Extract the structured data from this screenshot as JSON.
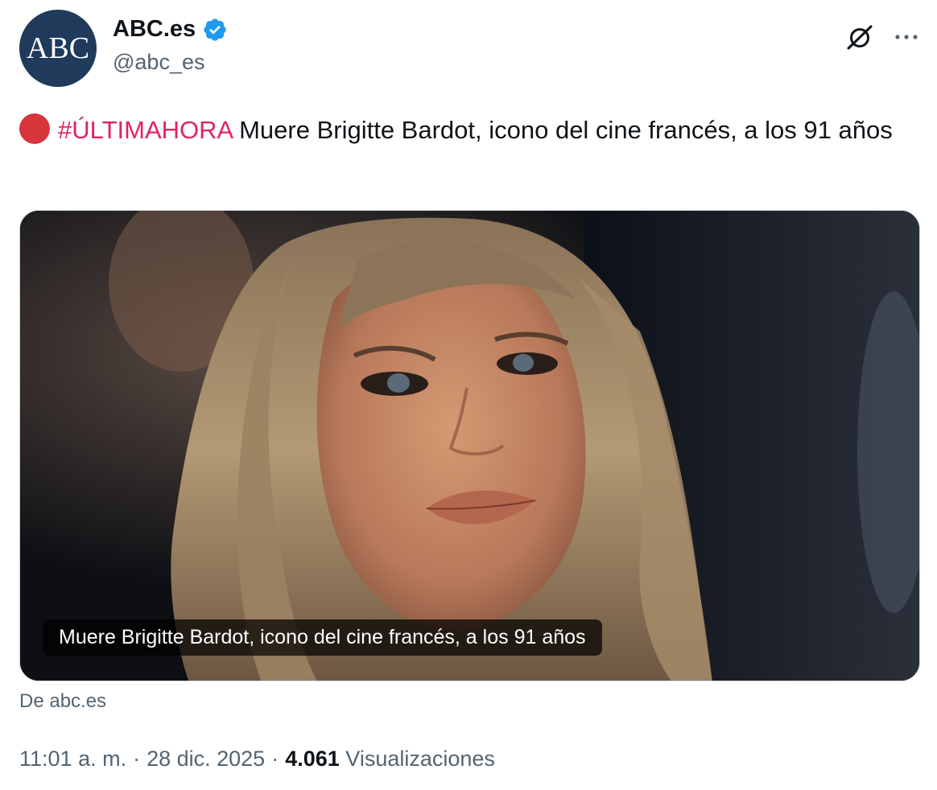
{
  "account": {
    "avatar_text": "ABC",
    "display_name": "ABC.es",
    "handle": "@abc_es"
  },
  "icons": {
    "verified": "verified-badge-icon",
    "grok": "grok-icon",
    "more": "more-options-icon",
    "breaking": "red-circle-icon"
  },
  "tweet": {
    "hashtag": "#ÚLTIMAHORA",
    "text": " Muere Brigitte Bardot, icono del cine francés, a los 91 años"
  },
  "card": {
    "caption": "Muere Brigitte Bardot, icono del cine francés, a los 91 años",
    "source": "De abc.es"
  },
  "meta": {
    "time": "11:01 a. m.",
    "sep1": "·",
    "date": "28 dic. 2025",
    "sep2": "·",
    "views_count": "4.061",
    "views_label": "Visualizaciones"
  },
  "colors": {
    "hashtag": "#e0245e",
    "breaking_dot": "#d8343c",
    "verified": "#1d9bf0",
    "secondary_text": "#536471",
    "avatar_bg": "#1f3a5a"
  }
}
